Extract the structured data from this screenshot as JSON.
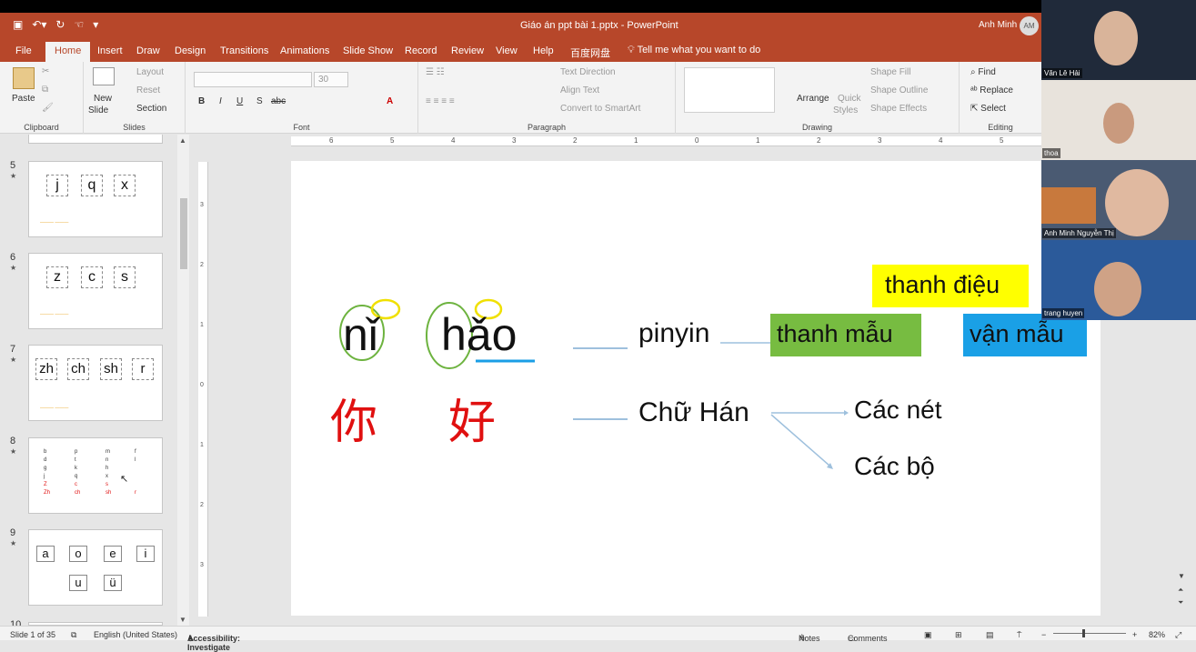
{
  "window": {
    "title": "Giáo án ppt bài 1.pptx - PowerPoint",
    "user_name": "Anh Minh",
    "user_initials": "AM"
  },
  "quick_access": [
    "save-icon",
    "undo-icon",
    "redo-icon",
    "touch-mode-icon",
    "customize-icon"
  ],
  "tabs": [
    "File",
    "Home",
    "Insert",
    "Draw",
    "Design",
    "Transitions",
    "Animations",
    "Slide Show",
    "Record",
    "Review",
    "View",
    "Help",
    "百度网盘"
  ],
  "active_tab": "Home",
  "tell_me": "Tell me what you want to do",
  "ribbon": {
    "clipboard": {
      "paste": "Paste",
      "label": "Clipboard"
    },
    "slides": {
      "new_slide": "New",
      "new_slide_2": "Slide",
      "layout": "Layout",
      "reset": "Reset",
      "section": "Section",
      "label": "Slides"
    },
    "font": {
      "size": "30",
      "label": "Font"
    },
    "paragraph": {
      "text_direction": "Text Direction",
      "align_text": "Align Text",
      "convert": "Convert to SmartArt",
      "label": "Paragraph"
    },
    "drawing": {
      "arrange": "Arrange",
      "quick_styles": "Quick",
      "quick_styles_2": "Styles",
      "shape_fill": "Shape Fill",
      "shape_outline": "Shape Outline",
      "shape_effects": "Shape Effects",
      "label": "Drawing"
    },
    "editing": {
      "find": "Find",
      "replace": "Replace",
      "select": "Select",
      "label": "Editing"
    }
  },
  "slide_panel": {
    "thumbnails": [
      {
        "number": "5",
        "letters": [
          "j",
          "q",
          "x"
        ]
      },
      {
        "number": "6",
        "letters": [
          "z",
          "c",
          "s"
        ]
      },
      {
        "number": "7",
        "letters": [
          "zh",
          "ch",
          "sh",
          "r"
        ]
      },
      {
        "number": "8",
        "columns": [
          [
            "b",
            "d",
            "g",
            "j",
            "Z",
            "Zh"
          ],
          [
            "p",
            "t",
            "k",
            "q",
            "c",
            "ch"
          ],
          [
            "m",
            "n",
            "h",
            "x",
            "s",
            "sh"
          ],
          [
            "f",
            "l",
            "",
            "",
            "",
            "r"
          ]
        ]
      },
      {
        "number": "9",
        "row1": [
          "a",
          "o",
          "e",
          "i"
        ],
        "row2": [
          "u",
          "ü"
        ]
      },
      {
        "number": "10"
      }
    ]
  },
  "ruler": {
    "h_labels": [
      "6",
      "5",
      "4",
      "3",
      "2",
      "1",
      "0",
      "1",
      "2",
      "3",
      "4",
      "5",
      "6"
    ],
    "v_labels": [
      "3",
      "2",
      "1",
      "0",
      "1",
      "2",
      "3"
    ]
  },
  "slide": {
    "ni": "nǐ",
    "hao": "hǎo",
    "hanzi_ni": "你",
    "hanzi_hao": "好",
    "pinyin": "pinyin",
    "chu_han": "Chữ Hán",
    "thanh_mau": "thanh mẫu",
    "van_mau": "vận mẫu",
    "thanh_dieu": "thanh điệu",
    "cac_net": "Các nét",
    "cac_bo": "Các bộ",
    "colors": {
      "green_box": "#77bc41",
      "blue_box": "#1aa0e6",
      "yellow_box": "#ffff00",
      "red_text": "#e01010"
    }
  },
  "status": {
    "slide_info": "Slide 1 of 35",
    "language": "English (United States)",
    "accessibility": "Accessibility: Investigate",
    "notes": "Notes",
    "comments": "Comments",
    "zoom": "82%"
  },
  "participants": [
    {
      "name": "Văn Lê Hải"
    },
    {
      "name": "thoa"
    },
    {
      "name": "Anh Minh Nguyễn Thị"
    },
    {
      "name": "trang huyen"
    }
  ]
}
